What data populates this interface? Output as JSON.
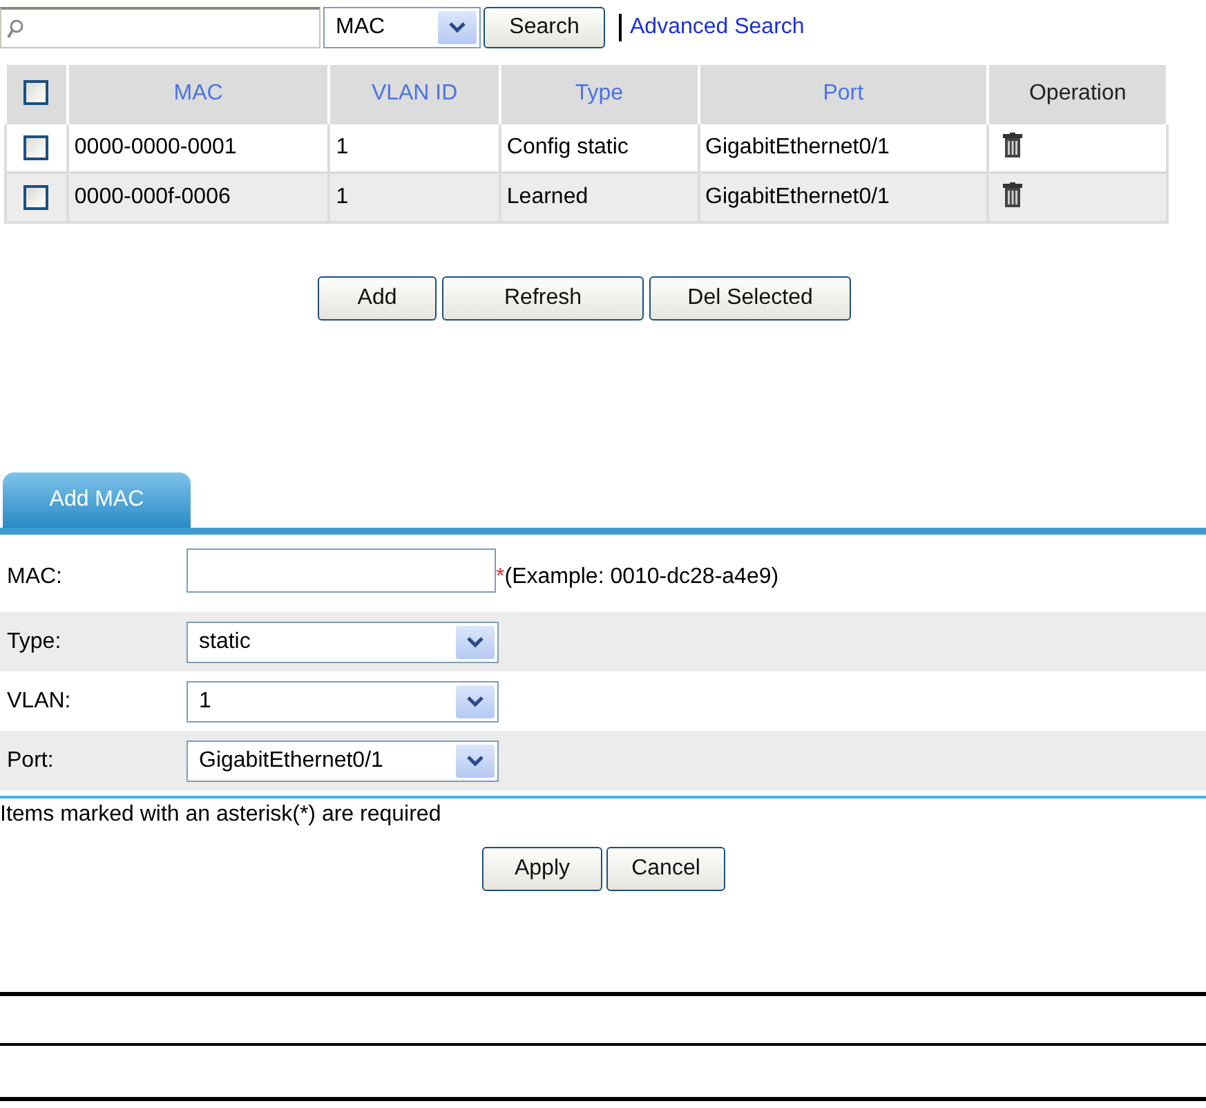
{
  "search": {
    "field": "MAC",
    "button": "Search",
    "advanced_link": "Advanced Search"
  },
  "table": {
    "select_all_checked": false,
    "columns": [
      "MAC",
      "VLAN ID",
      "Type",
      "Port",
      "Operation"
    ],
    "rows": [
      {
        "checked": false,
        "mac": "0000-0000-0001",
        "vlan": "1",
        "type": "Config static",
        "port": "GigabitEthernet0/1"
      },
      {
        "checked": false,
        "mac": "0000-000f-0006",
        "vlan": "1",
        "type": "Learned",
        "port": "GigabitEthernet0/1"
      }
    ]
  },
  "table_buttons": [
    "Add",
    "Refresh",
    "Del Selected"
  ],
  "form": {
    "tab": {
      "label": "Add MAC",
      "selected": true
    },
    "fields": [
      {
        "kind": "text",
        "label": "MAC:",
        "required_mark": "*",
        "hint": "(Example: 0010-dc28-a4e9)"
      },
      {
        "kind": "select",
        "label": "Type:",
        "value": "static"
      },
      {
        "kind": "select",
        "label": "VLAN:",
        "value": "1"
      },
      {
        "kind": "select",
        "label": "Port:",
        "value": "GigabitEthernet0/1"
      }
    ],
    "note": "Items marked with an asterisk(*) are required",
    "buttons": [
      "Apply",
      "Cancel"
    ]
  }
}
